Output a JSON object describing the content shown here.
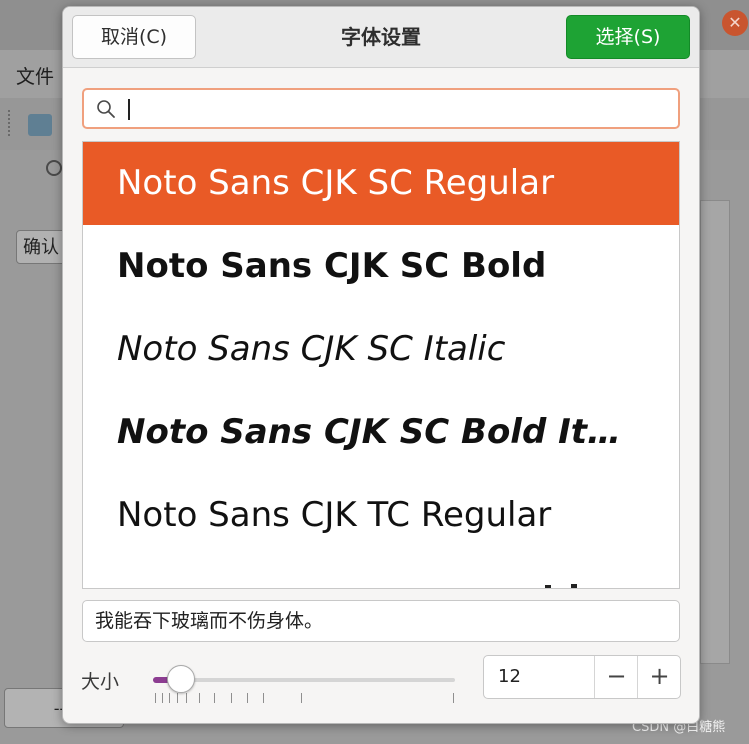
{
  "background_app": {
    "menu_file": "文件",
    "confirm_button": "确认",
    "bottom_button": "--v",
    "close_glyph": "✕",
    "watermark": "CSDN @白糖熊"
  },
  "dialog": {
    "title": "字体设置",
    "cancel_label": "取消(C)",
    "select_label": "选择(S)"
  },
  "search": {
    "value": "",
    "placeholder": ""
  },
  "font_list": {
    "selected_index": 0,
    "items": [
      {
        "label": "Noto Sans CJK SC Regular"
      },
      {
        "label": "Noto Sans CJK SC Bold"
      },
      {
        "label": "Noto Sans CJK SC Italic"
      },
      {
        "label": "Noto Sans CJK SC Bold Italic"
      },
      {
        "label": "Noto Sans CJK TC Regular"
      }
    ]
  },
  "preview": {
    "text": "我能吞下玻璃而不伤身体。"
  },
  "size": {
    "label": "大小",
    "value": "12",
    "minus_glyph": "−",
    "plus_glyph": "+"
  },
  "colors": {
    "selected_row": "#e95a26",
    "select_button": "#1ea334",
    "slider_fill": "#8c3d91",
    "search_border": "#f0a07e"
  },
  "icons": [
    "search-icon",
    "close-icon",
    "minus-icon",
    "plus-icon"
  ]
}
